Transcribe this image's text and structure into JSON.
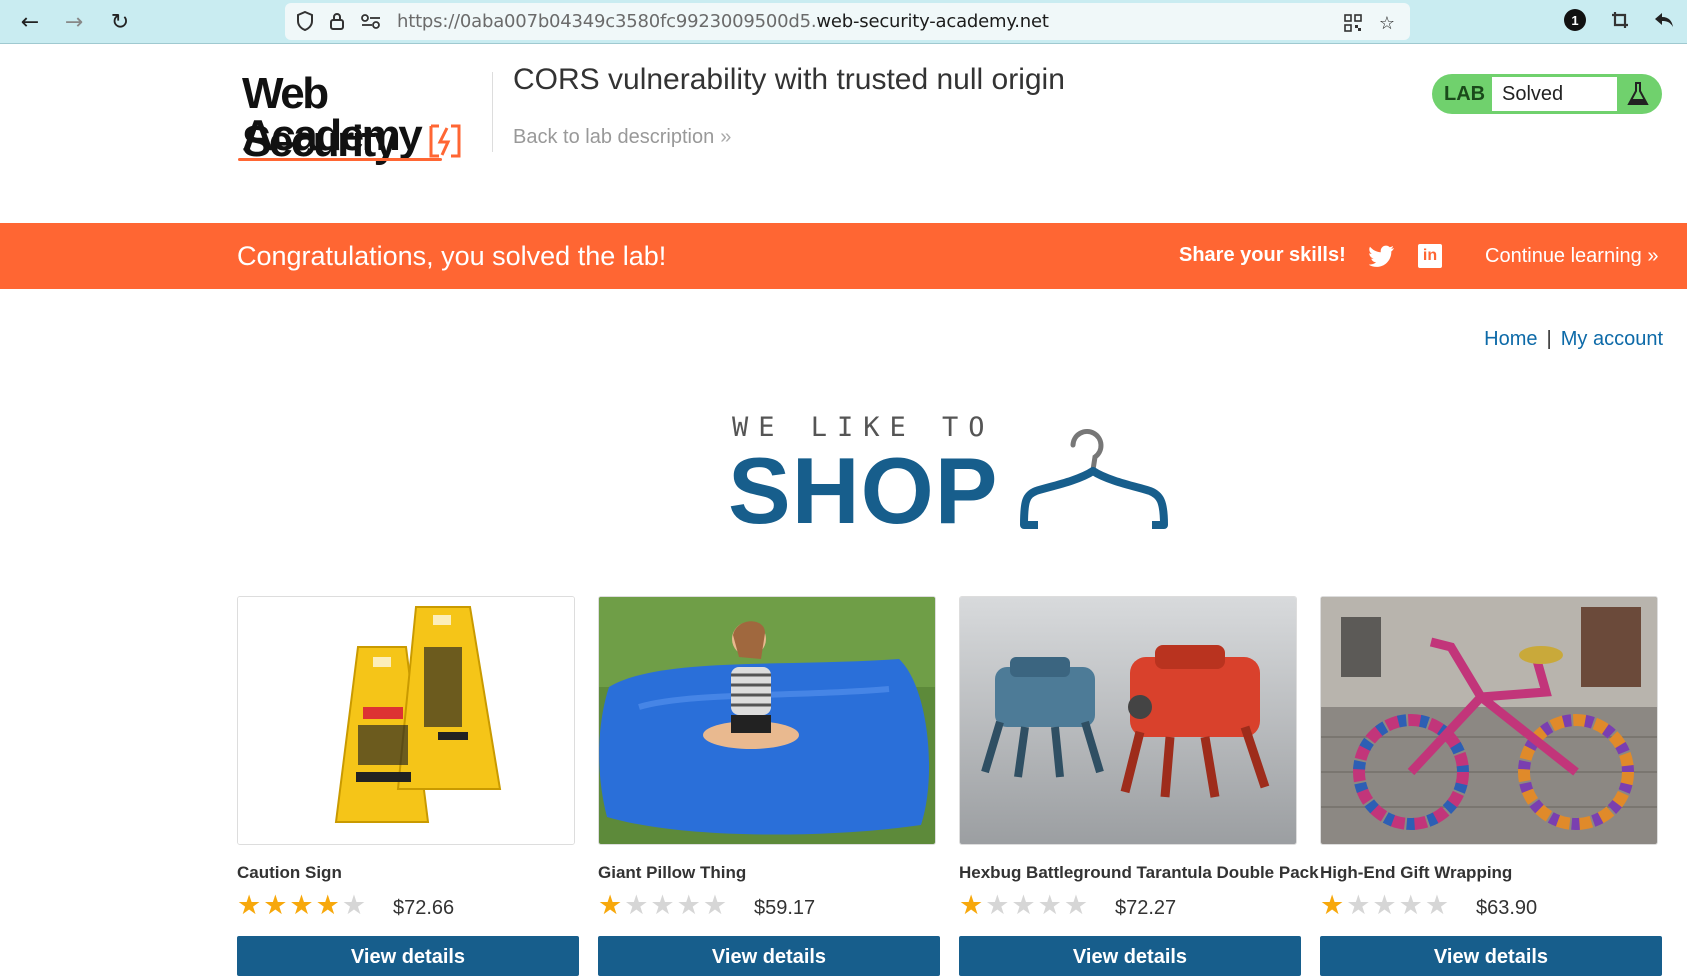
{
  "browser": {
    "url_prefix": "https://0aba007b04349c3580fc9923009500d5.",
    "url_host": "web-security-academy.net",
    "notification_count": "1"
  },
  "header": {
    "logo_line1": "Web Security",
    "logo_line2": "Academy",
    "lab_title": "CORS vulnerability with trusted null origin",
    "back_link": "Back to lab description",
    "lab_badge": "LAB",
    "lab_status": "Solved"
  },
  "banner": {
    "message": "Congratulations, you solved the lab!",
    "share": "Share your skills!",
    "continue": "Continue learning",
    "linkedin": "in"
  },
  "nav": {
    "home": "Home",
    "separator": "|",
    "account": "My account"
  },
  "hero": {
    "tagline": "WE LIKE TO",
    "title": "SHOP"
  },
  "products": [
    {
      "name": "Caution Sign",
      "rating": 4,
      "price": "$72.66",
      "button": "View details"
    },
    {
      "name": "Giant Pillow Thing",
      "rating": 1,
      "price": "$59.17",
      "button": "View details"
    },
    {
      "name": "Hexbug Battleground Tarantula Double Pack",
      "rating": 1,
      "price": "$72.27",
      "button": "View details"
    },
    {
      "name": "High-End Gift Wrapping",
      "rating": 1,
      "price": "$63.90",
      "button": "View details"
    }
  ],
  "colors": {
    "accent_orange": "#ff6633",
    "brand_blue": "#175e8c",
    "link_blue": "#0d6aa8",
    "solved_green": "#70d16d",
    "star_gold": "#f7a80c"
  }
}
